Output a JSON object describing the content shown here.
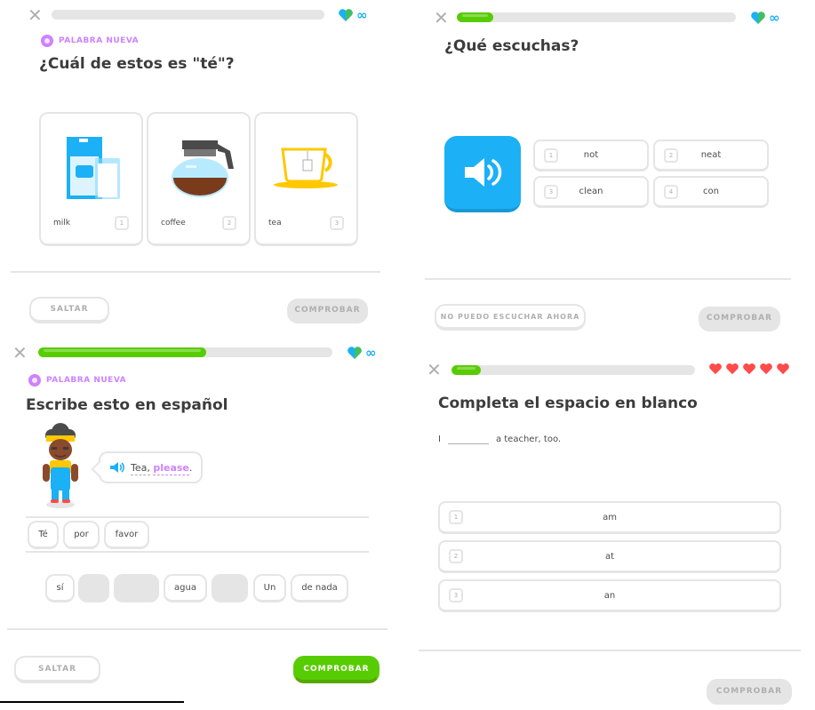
{
  "panel1": {
    "badge": "PALABRA NUEVA",
    "title": "¿Cuál de estos es \"té\"?",
    "progress": 0,
    "cards": [
      {
        "label": "milk",
        "key": "1",
        "icon": "milk-carton-icon"
      },
      {
        "label": "coffee",
        "key": "2",
        "icon": "coffee-pot-icon"
      },
      {
        "label": "tea",
        "key": "3",
        "icon": "teacup-icon"
      }
    ],
    "skip_label": "SALTAR",
    "check_label": "COMPROBAR",
    "infinity": "∞"
  },
  "panel2": {
    "title": "¿Qué escuchas?",
    "progress": 0.13,
    "options": [
      {
        "key": "1",
        "label": "not"
      },
      {
        "key": "2",
        "label": "neat"
      },
      {
        "key": "3",
        "label": "clean"
      },
      {
        "key": "4",
        "label": "con"
      }
    ],
    "cant_listen_label": "NO PUEDO ESCUCHAR AHORA",
    "check_label": "COMPROBAR",
    "infinity": "∞"
  },
  "panel3": {
    "badge": "PALABRA NUEVA",
    "title": "Escribe esto en español",
    "progress": 0.57,
    "bubble": {
      "word1": "Tea,",
      "word2": "please",
      "period": "."
    },
    "answer_tiles": [
      "Té",
      "por",
      "favor"
    ],
    "bank_tiles": [
      "sí",
      "",
      "",
      "agua",
      "",
      "Un",
      "de nada"
    ],
    "skip_label": "SALTAR",
    "check_label": "COMPROBAR",
    "infinity": "∞"
  },
  "panel4": {
    "title": "Completa el espacio en blanco",
    "progress": 0.12,
    "hearts": 5,
    "sentence_start": "I",
    "sentence_end": "a teacher, too.",
    "options": [
      {
        "key": "1",
        "label": "am"
      },
      {
        "key": "2",
        "label": "at"
      },
      {
        "key": "3",
        "label": "an"
      }
    ],
    "check_label": "COMPROBAR"
  },
  "colors": {
    "green": "#58cc02",
    "blue": "#1cb0f6",
    "purple": "#ce82ff",
    "red": "#ff4b4b",
    "gray": "#e5e5e5"
  }
}
